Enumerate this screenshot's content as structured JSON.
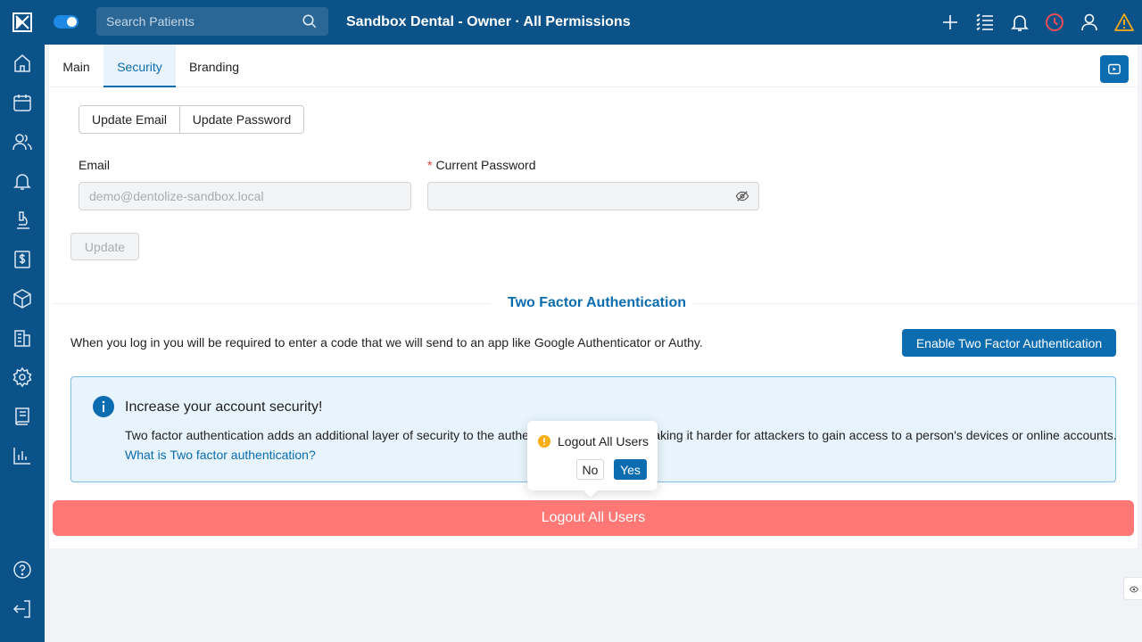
{
  "topbar": {
    "search_placeholder": "Search Patients",
    "title": "Sandbox Dental - Owner · All Permissions"
  },
  "sidebar": {
    "icons": [
      "logo-icon",
      "home-icon",
      "calendar-icon",
      "patients-icon",
      "notifications-icon",
      "microscope-icon",
      "billing-icon",
      "inventory-icon",
      "building-icon",
      "settings-icon",
      "reports-icon",
      "analytics-icon",
      "help-icon",
      "logout-icon"
    ]
  },
  "tabs": [
    {
      "label": "Main",
      "active": false
    },
    {
      "label": "Security",
      "active": true
    },
    {
      "label": "Branding",
      "active": false
    }
  ],
  "segmented": {
    "update_email": "Update Email",
    "update_password": "Update Password"
  },
  "form": {
    "email_label": "Email",
    "email_value": "demo@dentolize-sandbox.local",
    "password_required_mark": "*",
    "password_label": "Current Password",
    "update_button": "Update"
  },
  "two_factor": {
    "title": "Two Factor Authentication",
    "description": "When you log in you will be required to enter a code that we will send to an app like Google Authenticator or Authy.",
    "enable_button": "Enable Two Factor Authentication",
    "alert_title": "Increase your account security!",
    "alert_body": "Two factor authentication adds an additional layer of security to the authentication process by making it harder for attackers to gain access to a person's devices or online accounts.",
    "alert_link": "What is Two factor authentication?"
  },
  "logout_all_button": "Logout All Users",
  "popconfirm": {
    "title": "Logout All Users",
    "no": "No",
    "yes": "Yes"
  },
  "colors": {
    "brand": "#0b5289",
    "primary": "#0b6cb0",
    "danger": "#ff7875",
    "warning": "#faad14"
  }
}
